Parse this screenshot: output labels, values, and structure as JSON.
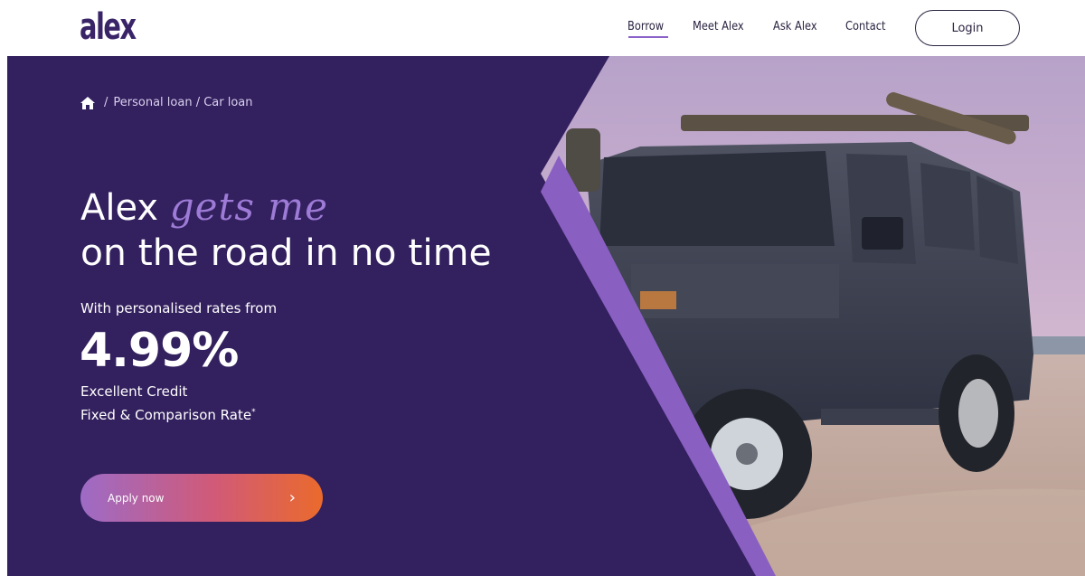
{
  "header": {
    "logo": "alex",
    "nav": [
      "Borrow",
      "Meet Alex",
      "Ask Alex",
      "Contact"
    ],
    "active_nav": "Borrow",
    "login_label": "Login"
  },
  "breadcrumb": {
    "home_icon": "home-icon",
    "separator": "/",
    "path": "Personal loan / Car loan"
  },
  "hero": {
    "heading_start": "Alex",
    "heading_script": "gets me",
    "heading_line2": "on the road in no time",
    "subtitle": "With personalised rates from",
    "rate": "4.99%",
    "credit_label": "Excellent Credit",
    "rate_type": "Fixed & Comparison Rate",
    "rate_footnote": "*",
    "cta_label": "Apply now",
    "cta_icon": "chevron-right-icon"
  },
  "colors": {
    "brand_purple": "#3a2468",
    "panel_purple": "#33205e",
    "accent_lilac": "#9d7bd6",
    "stripe_purple": "#8a5fc2",
    "cta_gradient_start": "#9d6bc6",
    "cta_gradient_end": "#ea6a2c"
  }
}
